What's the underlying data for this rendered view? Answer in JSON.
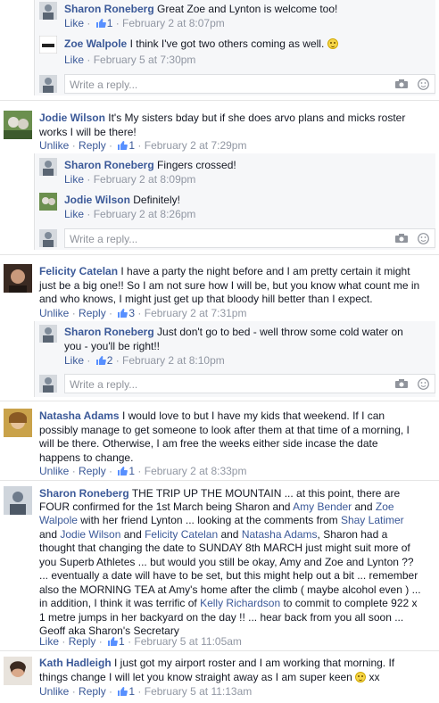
{
  "labels": {
    "like": "Like",
    "unlike": "Unlike",
    "reply": "Reply",
    "reply_placeholder": "Write a reply...",
    "sep": " · "
  },
  "replies_1": [
    {
      "name": "Sharon Roneberg",
      "text": "Great Zoe and Lynton is welcome too!",
      "likes": "1",
      "time": "February 2 at 8:07pm"
    },
    {
      "name": "Zoe Walpole",
      "text": "I think I've got two others coming as well.",
      "time": "February 5 at 7:30pm"
    }
  ],
  "comment_jodie": {
    "name": "Jodie Wilson",
    "text_l1": "It's My sisters bday but if she does arvo plans and micks roster",
    "text_l2": "works I will be there!",
    "likes": "1",
    "time": "February 2 at 7:29pm"
  },
  "replies_2": [
    {
      "name": "Sharon Roneberg",
      "text": "Fingers crossed!",
      "time": "February 2 at 8:09pm"
    },
    {
      "name": "Jodie Wilson",
      "text": "Definitely!",
      "time": "February 2 at 8:26pm"
    }
  ],
  "comment_felicity": {
    "name": "Felicity Catelan",
    "text_l1": "I have a party the night before and I am pretty certain it might",
    "text_l2": "just be a big one!! So I am not sure how I will be, but you know what count me in",
    "text_l3": "and who knows, I might just get up that bloody hill better than I expect.",
    "likes": "3",
    "time": "February 2 at 7:31pm"
  },
  "reply_felicity": {
    "name": "Sharon Roneberg",
    "text_l1": "Just don't go to bed - well throw some cold water on",
    "text_l2": "you - you'll be right!!",
    "likes": "2",
    "time": "February 2 at 8:10pm"
  },
  "comment_natasha": {
    "name": "Natasha Adams",
    "text_l1": "I would love to but I have my kids that weekend. If I can",
    "text_l2": "possibly manage to get someone to look after them at that time of a morning, I",
    "text_l3": "will be there. Otherwise, I am free the weeks either side incase the date",
    "text_l4": "happens to change.",
    "likes": "1",
    "time": "February 2 at 8:33pm"
  },
  "comment_sharon": {
    "name": "Sharon Roneberg",
    "l1": "THE TRIP UP THE MOUNTAIN ... at this point, there are",
    "l2a": "FOUR confirmed for the 1st March being Sharon and ",
    "l2b": "Amy Bender",
    "l2c": " and ",
    "l2d": "Zoe",
    "l3a": "Walpole",
    "l3b": " with her friend Lynton ... looking at the comments from ",
    "l3c": "Shay Latimer",
    "l4a": "and ",
    "l4b": "Jodie Wilson",
    "l4c": " and ",
    "l4d": "Felicity Catelan",
    "l4e": " and ",
    "l4f": "Natasha Adams",
    "l4g": ", Sharon had a",
    "l5": "thought that changing the date to SUNDAY 8th MARCH just might suit more of",
    "l6": "you Superb Athletes ... but would you still be okay, Amy and Zoe and Lynton ??",
    "l7": "... eventually a date will have to be set, but this might help out a bit ... remember",
    "l8": "also the MORNING TEA at Amy's home after the climb ( maybe alcohol even ) ...",
    "l9a": "in addition, I think it was terrific of ",
    "l9b": "Kelly Richardson",
    "l9c": " to commit to complete 922 x",
    "l10": "1 metre jumps in her backyard on the day !! ... hear back from you all soon ...",
    "l11": "Geoff aka Sharon's Secretary",
    "likes": "1",
    "time": "February 5 at 11:05am"
  },
  "comment_kath": {
    "name": "Kath Hadleigh",
    "text_l1": "I just got my airport roster and I am working that morning. If",
    "text_l2": "things change I will let you know straight away as I am super keen",
    "text_tail": "xx",
    "likes": "1",
    "time": "February 5 at 11:13am"
  },
  "colors": {
    "link": "#3b5998",
    "meta": "#9197a3",
    "reply_bg": "#f6f7f9"
  },
  "icons": [
    "thumbs-up-icon",
    "camera-icon",
    "emoji-icon",
    "smiley-emoticon-icon"
  ]
}
